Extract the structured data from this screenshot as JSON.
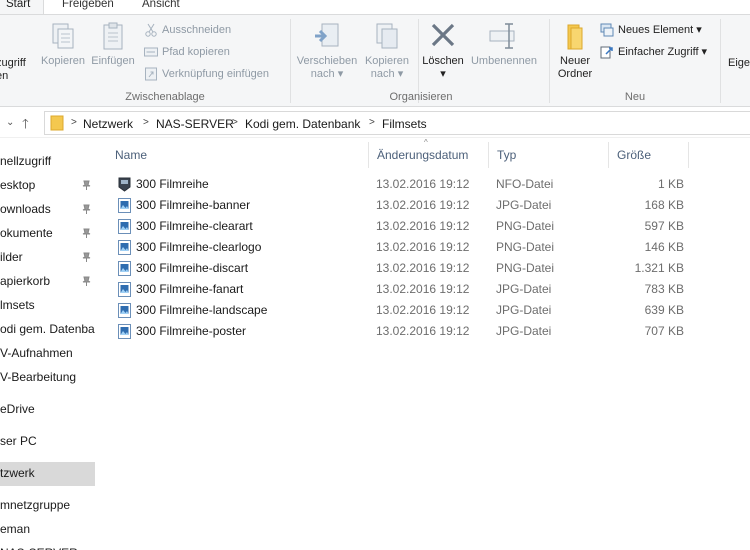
{
  "tabs": [
    "Start",
    "Freigeben",
    "Ansicht"
  ],
  "ribbon": {
    "clipboard": {
      "label": "Zwischenablage",
      "quick_access_1": "zugriff",
      "quick_access_2": "en",
      "copy": "Kopieren",
      "paste": "Einfügen",
      "cut": "Ausschneiden",
      "copy_path": "Pfad kopieren",
      "paste_shortcut": "Verknüpfung einfügen"
    },
    "organize": {
      "label": "Organisieren",
      "move_1": "Verschieben",
      "move_2": "nach ▾",
      "copy_1": "Kopieren",
      "copy_2": "nach ▾",
      "delete": "Löschen",
      "delete_arrow": "▾",
      "rename": "Umbenennen"
    },
    "new": {
      "label": "Neu",
      "new_folder_1": "Neuer",
      "new_folder_2": "Ordner",
      "new_item": "Neues Element ▾",
      "easy_access": "Einfacher Zugriff ▾"
    },
    "properties_partial": "Eige"
  },
  "address": {
    "crumbs": [
      "Netzwerk",
      "NAS-SERVER",
      "Kodi gem. Datenbank",
      "Filmsets"
    ],
    "separator": ">"
  },
  "nav": {
    "items": [
      "nellzugriff",
      "esktop",
      "ownloads",
      "okumente",
      "ilder",
      "apierkorb",
      "lmsets",
      "odi gem. Datenbank",
      "V-Aufnahmen",
      "V-Bearbeitung",
      "eDrive",
      "ser PC",
      "tzwerk",
      "mnetzgruppe",
      "eman",
      "NAS-SERVER"
    ]
  },
  "columns": {
    "name": "Name",
    "date": "Änderungsdatum",
    "type": "Typ",
    "size": "Größe"
  },
  "files": [
    {
      "name": "300 Filmreihe",
      "date": "13.02.2016 19:12",
      "type": "NFO-Datei",
      "size": "1 KB"
    },
    {
      "name": "300 Filmreihe-banner",
      "date": "13.02.2016 19:12",
      "type": "JPG-Datei",
      "size": "168 KB"
    },
    {
      "name": "300 Filmreihe-clearart",
      "date": "13.02.2016 19:12",
      "type": "PNG-Datei",
      "size": "597 KB"
    },
    {
      "name": "300 Filmreihe-clearlogo",
      "date": "13.02.2016 19:12",
      "type": "PNG-Datei",
      "size": "146 KB"
    },
    {
      "name": "300 Filmreihe-discart",
      "date": "13.02.2016 19:12",
      "type": "PNG-Datei",
      "size": "1.321 KB"
    },
    {
      "name": "300 Filmreihe-fanart",
      "date": "13.02.2016 19:12",
      "type": "JPG-Datei",
      "size": "783 KB"
    },
    {
      "name": "300 Filmreihe-landscape",
      "date": "13.02.2016 19:12",
      "type": "JPG-Datei",
      "size": "639 KB"
    },
    {
      "name": "300 Filmreihe-poster",
      "date": "13.02.2016 19:12",
      "type": "JPG-Datei",
      "size": "707 KB"
    }
  ],
  "colors": {
    "ribbon_bg": "#f5f6f7",
    "header_text": "#4c607a",
    "selected_nav": "#d9d9d9",
    "folder_yellow": "#f4c84f"
  }
}
